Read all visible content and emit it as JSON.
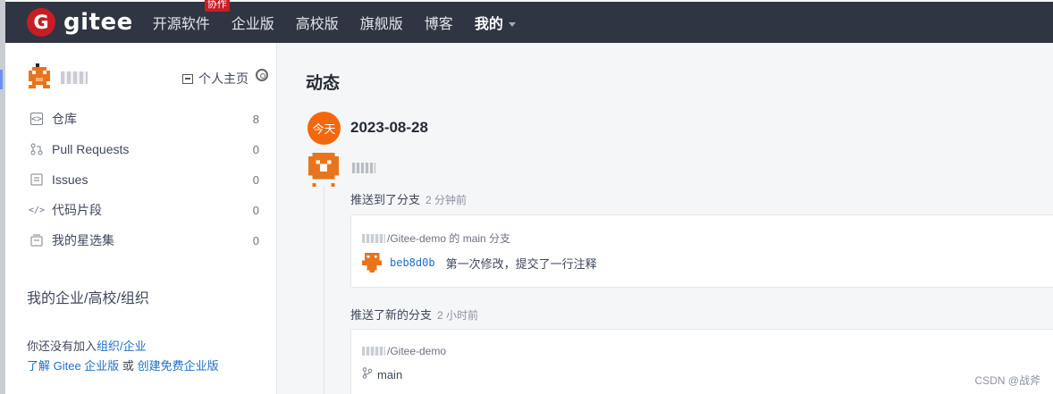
{
  "nav": {
    "logo_letter": "G",
    "logo_text": "gitee",
    "items": [
      {
        "label": "开源软件",
        "badge": "协作"
      },
      {
        "label": "企业版"
      },
      {
        "label": "高校版"
      },
      {
        "label": "旗舰版"
      },
      {
        "label": "博客"
      },
      {
        "label": "我的"
      }
    ]
  },
  "sidebar": {
    "home_link": "个人主页",
    "menu": [
      {
        "label": "仓库",
        "count": "8"
      },
      {
        "label": "Pull Requests",
        "count": "0"
      },
      {
        "label": "Issues",
        "count": "0"
      },
      {
        "label": "代码片段",
        "count": "0"
      },
      {
        "label": "我的星选集",
        "count": "0"
      }
    ],
    "org_title": "我的企业/高校/组织",
    "org_line1_prefix": "你还没有加入",
    "org_link_org": "组织",
    "org_sep": "/",
    "org_link_ent": "企业",
    "org_link_learn": "了解 Gitee 企业版",
    "org_or": "或",
    "org_link_create": "创建免费企业版"
  },
  "feed": {
    "title": "动态",
    "today_label": "今天",
    "date": "2023-08-28",
    "events": [
      {
        "action": "推送到了分支",
        "time": "2 分钟前",
        "repo": "/Gitee-demo 的 main 分支",
        "commit_hash": "beb8d0b",
        "commit_message": "第一次修改，提交了一行注释"
      },
      {
        "action": "推送了新的分支",
        "time": "2 小时前",
        "repo": "/Gitee-demo",
        "branch": "main"
      }
    ]
  },
  "watermark": "CSDN @战斧",
  "colors": {
    "nav_bg": "#2f3542",
    "brand_red": "#c71d23",
    "today_orange": "#f4670e",
    "link_blue": "#1e6fc6"
  }
}
